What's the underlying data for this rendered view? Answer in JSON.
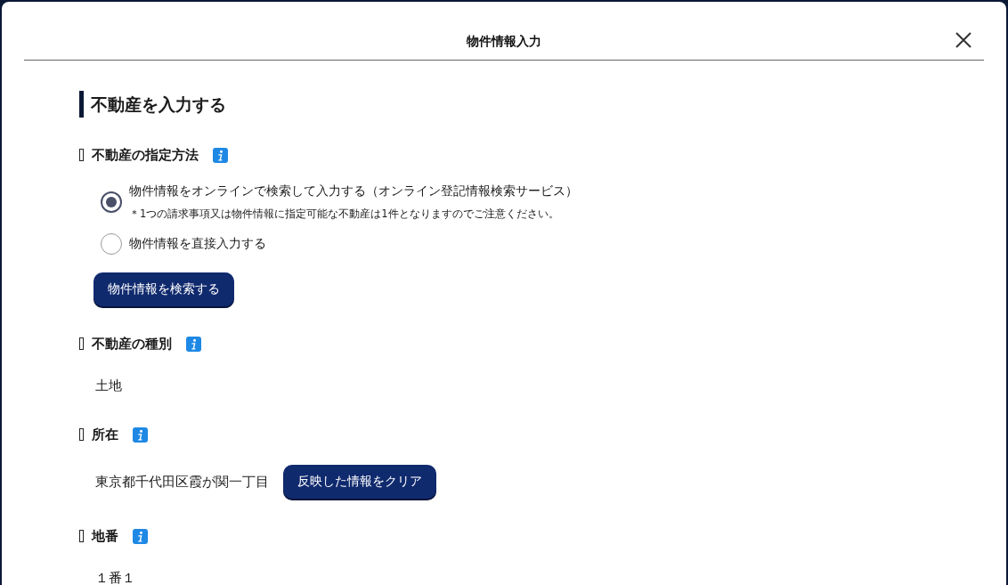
{
  "dialog": {
    "title": "物件情報入力"
  },
  "heading": "不動産を入力する",
  "fields": [
    {
      "kind": "radio-group",
      "label": "不動産の指定方法",
      "options": [
        {
          "label": "物件情報をオンラインで検索して入力する（オンライン登記情報検索サービス）",
          "note": "＊1つの請求事項又は物件情報に指定可能な不動産は1件となりますのでご注意ください。",
          "selected": true
        },
        {
          "label": "物件情報を直接入力する",
          "selected": false
        }
      ],
      "button": "物件情報を検索する"
    },
    {
      "kind": "value",
      "label": "不動産の種別",
      "value": "土地"
    },
    {
      "kind": "value",
      "label": "所在",
      "value": "東京都千代田区霞が関一丁目",
      "button": "反映した情報をクリア"
    },
    {
      "kind": "value",
      "label": "地番",
      "value": "１番１"
    }
  ]
}
